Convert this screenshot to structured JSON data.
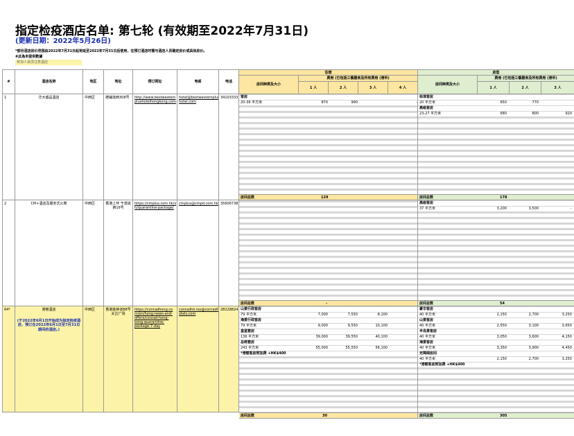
{
  "title": "指定检疫酒店名单: 第七轮 (有效期至2022年7月31日)",
  "updated": "(更新日期：2022年5月26日)",
  "notes": {
    "line1": "*部份酒店房价范围由2022年7月31日起将延至2022年7月31日后使用，在预订酒店时需与酒店人员确定房价或具体房价。",
    "line2": "#此為未提供數據",
    "line3": "參加人員須注意酒店"
  },
  "headers": {
    "no": "#",
    "hotel": "酒店名称",
    "district": "地区",
    "address": "地址",
    "website": "预订网址",
    "email": "电邮",
    "phone": "电话",
    "cat1": "住宿",
    "cat2": "房型",
    "roomtype": "房间种类及大小",
    "price_note": "费用 (已包括三餐膳食及所有费用 (港币)",
    "p1": "1 人",
    "p2": "2 人",
    "p3": "3 人",
    "p4": "4 人"
  },
  "rows": [
    {
      "no": "1",
      "hotel": "华大盛品酒店",
      "district": "中西区",
      "address": "德辅道西308号",
      "website": "http://www.bestwestern plushotelhongkong.com",
      "email": "hotel@bestwesternplus hotel.com",
      "phone": "34103333",
      "left_rooms": [
        {
          "label": "客房",
          "bold": true
        },
        {
          "label": "20-36 平方米",
          "v1": "870",
          "v2": "990",
          "v3": "",
          "v4": "-"
        }
      ],
      "right_rooms": [
        {
          "label": "标准客房",
          "bold": true
        },
        {
          "label": "20 平方米",
          "v1": "650",
          "v2": "770",
          "v3": ""
        },
        {
          "label": "高级客房",
          "bold": true
        },
        {
          "label": "23-27 平方米",
          "v1": "680",
          "v2": "800",
          "v3": "920"
        }
      ],
      "left_total_label": "房间总数",
      "left_total": "129",
      "right_total_label": "房间总数",
      "right_total": "178"
    },
    {
      "no": "2",
      "hotel": "CM+酒店及服务式公寓",
      "district": "中西区",
      "address": "香港上环 干诺道西16号",
      "website": "https://cmplus.com.hk/z h/quarantine-package/",
      "email": "cmplus@cmpd.com.hk",
      "phone": "35606738",
      "left_rooms": [],
      "right_rooms": [
        {
          "label": "高级客房",
          "bold": true
        },
        {
          "label": "37 平方米",
          "v1": "3,200",
          "v2": "3,500",
          "v3": "-"
        }
      ],
      "left_total_label": "房间总数",
      "left_total": "-",
      "right_total_label": "房间总数",
      "right_total": "54"
    },
    {
      "no": "64*",
      "hotel": "港丽酒店",
      "hotel_note": "(于2022年6月1日开始成为指定检疫酒店，预订在2022年6月1日至7月31日期间的酒店。)",
      "district": "中西区",
      "address": "香港金钟道88号 太古广场",
      "website": "https://conradhong.co m/en/hong-news-and-offers/conrad-hong-kong-quarantine-package-7-day",
      "email": "conradhk.res@conradh otels.com",
      "phone": "28228824",
      "left_rooms": [
        {
          "label": "山景行政客房",
          "bold": true
        },
        {
          "label": "79 平方米",
          "v1": "7,000",
          "v2": "7,550",
          "v3": "8,100",
          "v4": ""
        },
        {
          "label": "海景行政客房",
          "bold": true
        },
        {
          "label": "79 平方米",
          "v1": "9,000",
          "v2": "9,550",
          "v3": "10,100",
          "v4": ""
        },
        {
          "label": "皇室套房",
          "bold": true
        },
        {
          "label": "136 平方米",
          "v1": "39,000",
          "v2": "39,550",
          "v3": "40,100",
          "v4": ""
        },
        {
          "label": "总统套房",
          "bold": true
        },
        {
          "label": "243 平方米",
          "v1": "55,000",
          "v2": "55,550",
          "v3": "56,100",
          "v4": ""
        },
        {
          "label": "*港丽客房附加费 +HK$400",
          "bold": true
        }
      ],
      "right_rooms": [
        {
          "label": "豪华客房",
          "bold": true
        },
        {
          "label": "40 平方米",
          "v1": "2,150",
          "v2": "2,700",
          "v3": "3,250"
        },
        {
          "label": "山景客房",
          "bold": true
        },
        {
          "label": "40 平方米",
          "v1": "2,550",
          "v2": "3,100",
          "v3": "3,650"
        },
        {
          "label": "半岛景客房",
          "bold": true
        },
        {
          "label": "40 平方米",
          "v1": "3,050",
          "v2": "3,600",
          "v3": "4,150"
        },
        {
          "label": "海景客房",
          "bold": true
        },
        {
          "label": "40 平方米",
          "v1": "3,350",
          "v2": "3,900",
          "v3": "4,450"
        },
        {
          "label": "无障碍房间",
          "bold": true
        },
        {
          "label": "40 平方米",
          "v1": "2,150",
          "v2": "2,700",
          "v3": "3,250"
        },
        {
          "label": "*港丽客房附加费 +HK$400",
          "bold": true
        }
      ],
      "left_total_label": "房间总数",
      "left_total": "30",
      "right_total_label": "房间总数",
      "right_total": "305"
    }
  ],
  "colors": {
    "header_yellow": "#fce6a1",
    "header_green": "#dfeecf",
    "highlight_yellow": "#fce6a1",
    "stripe_grey": "#d6d6d6",
    "accent_blue": "#1a2fb0"
  }
}
